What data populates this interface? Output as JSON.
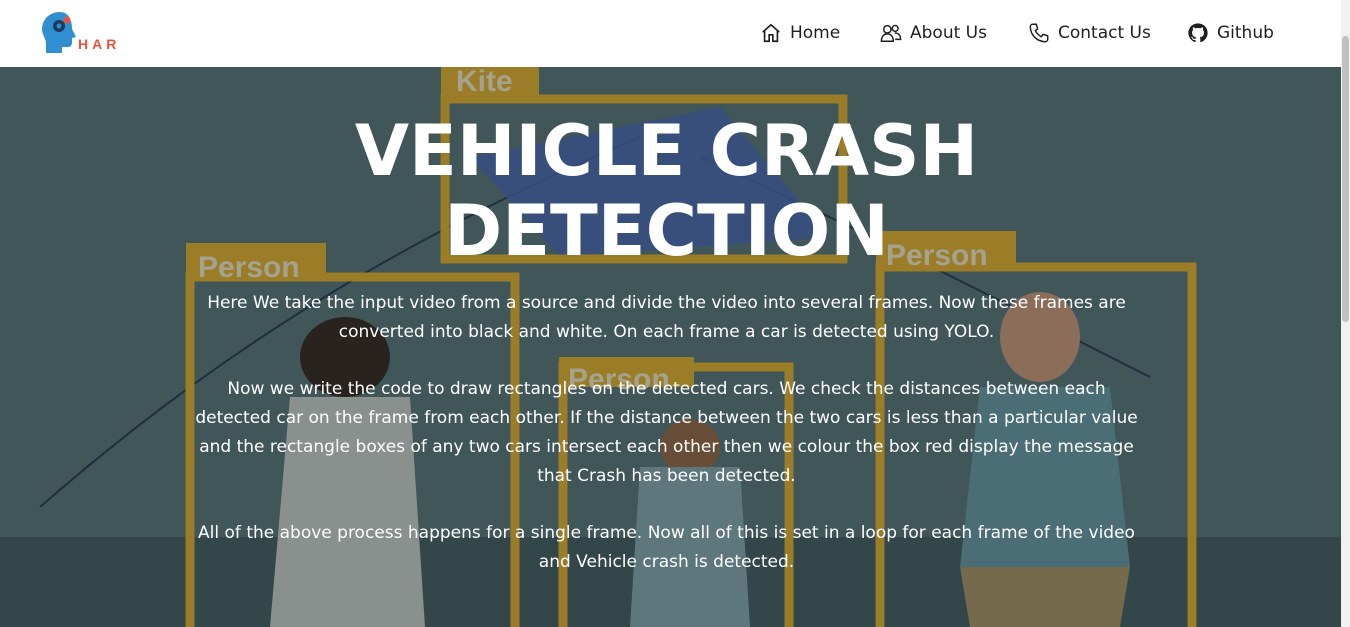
{
  "brand": {
    "logo_text": "HAR",
    "logo_icon": "head-gears-icon"
  },
  "nav": [
    {
      "label": "Home",
      "icon": "home-icon"
    },
    {
      "label": "About Us",
      "icon": "users-icon"
    },
    {
      "label": "Contact Us",
      "icon": "phone-icon"
    },
    {
      "label": "Github",
      "icon": "github-icon"
    }
  ],
  "hero": {
    "title_line1": "VEHICLE CRASH",
    "title_line2": "DETECTION",
    "paragraphs": [
      "Here We take the input video from a source and divide the video into several frames. Now these frames are converted into black and white. On each frame a car is detected using YOLO.",
      "Now we write the code to draw rectangles on the detected cars. We check the distances between each detected car on the frame from each other. If the distance between the two cars is less than a particular value and the rectangle boxes of any two cars intersect each other then we colour the box red display the message that Crash has been detected.",
      "All of the above process happens for a single frame. Now all of this is set in a loop for each frame of the video and Vehicle crash is detected."
    ],
    "detection_labels": [
      "Kite",
      "Person",
      "Person",
      "Person"
    ]
  },
  "colors": {
    "accent": "#e8543b",
    "box": "#d9a21e",
    "hero_bg": "#4a6468"
  }
}
